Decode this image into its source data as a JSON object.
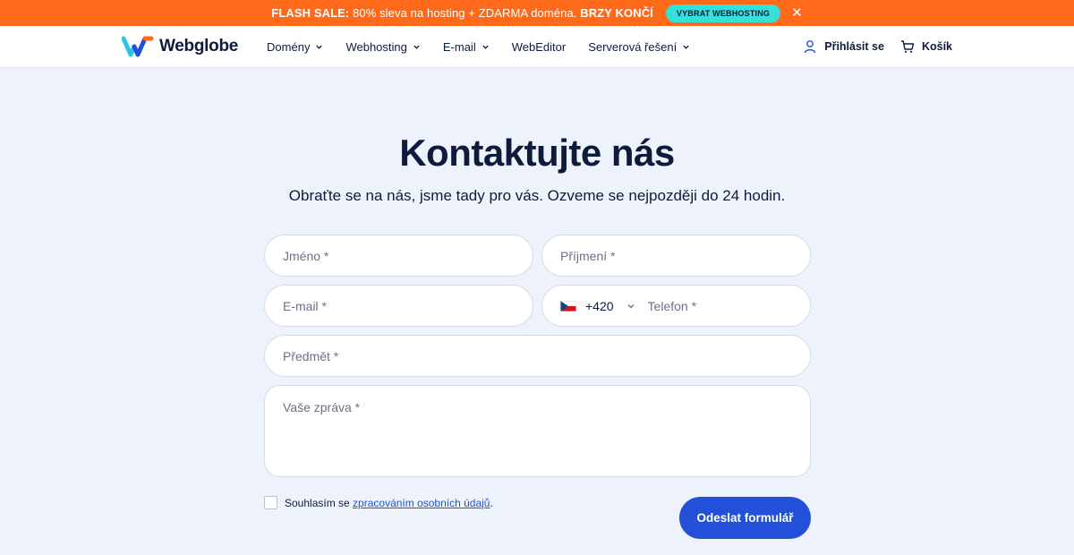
{
  "banner": {
    "bold_start": "FLASH SALE:",
    "text": " 80% sleva na hosting + ZDARMA doména. ",
    "bold_end": "BRZY KONČÍ",
    "cta": "VYBRAT WEBHOSTING",
    "close": "✕",
    "color": "#ff6a1a",
    "cta_color": "#34e0d8"
  },
  "header": {
    "logo_text": "Webglobe",
    "nav": [
      {
        "label": "Domény"
      },
      {
        "label": "Webhosting"
      },
      {
        "label": "E-mail"
      },
      {
        "label": "WebEditor"
      },
      {
        "label": "Serverová řešení"
      }
    ],
    "login": "Přihlásit se",
    "cart": "Košík"
  },
  "main": {
    "title": "Kontaktujte nás",
    "subtitle": "Obraťte se na nás, jsme tady pro vás. Ozveme se nejpozději do 24 hodin."
  },
  "form": {
    "first_name_placeholder": "Jméno *",
    "last_name_placeholder": "Příjmení *",
    "email_placeholder": "E-mail *",
    "phone_prefix": "+420",
    "phone_placeholder": "Telefon *",
    "subject_placeholder": "Předmět *",
    "message_placeholder": "Vaše zpráva *",
    "consent_text": "Souhlasím se ",
    "consent_link": "zpracováním osobních údajů",
    "consent_end": ".",
    "submit": "Odeslat formulář",
    "accent_color": "#2350d8"
  }
}
